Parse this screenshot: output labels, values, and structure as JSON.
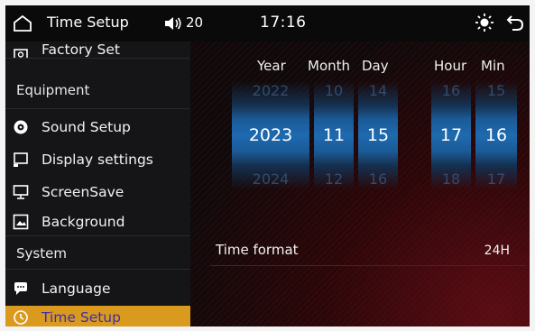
{
  "topbar": {
    "title": "Time Setup",
    "volume": "20",
    "clock": "17:16"
  },
  "sidebar": {
    "items": [
      {
        "label": "Factory Set",
        "icon": "factory-icon"
      },
      {
        "label": "Equipment",
        "type": "section"
      },
      {
        "label": "Sound Setup",
        "icon": "sound-icon"
      },
      {
        "label": "Display settings",
        "icon": "display-icon"
      },
      {
        "label": "ScreenSave",
        "icon": "monitor-icon"
      },
      {
        "label": "Background",
        "icon": "background-icon"
      },
      {
        "label": "System",
        "type": "section"
      },
      {
        "label": "Language",
        "icon": "language-icon"
      },
      {
        "label": "Time Setup",
        "icon": "clock-icon",
        "active": true
      }
    ]
  },
  "picker": {
    "columns": [
      {
        "label": "Year",
        "prev": "2022",
        "current": "2023",
        "next": "2024"
      },
      {
        "label": "Month",
        "prev": "10",
        "current": "11",
        "next": "12"
      },
      {
        "label": "Day",
        "prev": "14",
        "current": "15",
        "next": "16"
      },
      {
        "label": "Hour",
        "prev": "16",
        "current": "17",
        "next": "18"
      },
      {
        "label": "Min",
        "prev": "15",
        "current": "16",
        "next": "17"
      }
    ]
  },
  "time_format": {
    "label": "Time format",
    "value": "24H"
  },
  "colors": {
    "active_bg": "#d99a1e",
    "active_text": "#3d2fb0",
    "picker_blue": "#1e6ab0"
  }
}
